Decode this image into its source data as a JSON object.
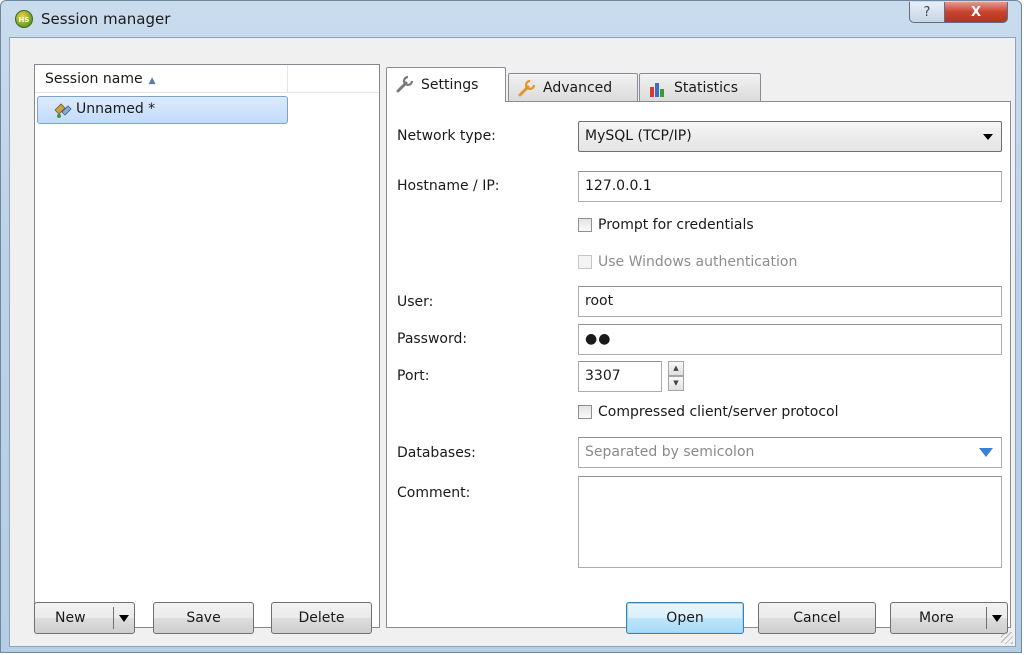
{
  "window": {
    "title": "Session manager",
    "icon": "heidisql-icon",
    "icon_text": "HS",
    "help_glyph": "?",
    "close_glyph": "X"
  },
  "session_list": {
    "column_header": "Session name",
    "sort_glyph": "▲",
    "items": [
      {
        "label": "Unnamed *",
        "icon": "connection-icon",
        "selected": true
      }
    ]
  },
  "tabs": [
    {
      "label": "Settings",
      "icon": "wrench-icon",
      "active": true
    },
    {
      "label": "Advanced",
      "icon": "wrench-icon",
      "active": false
    },
    {
      "label": "Statistics",
      "icon": "bar-chart-icon",
      "active": false
    }
  ],
  "settings": {
    "network_type": {
      "label": "Network type:",
      "value": "MySQL (TCP/IP)"
    },
    "hostname": {
      "label": "Hostname / IP:",
      "value": "127.0.0.1"
    },
    "prompt_credentials": {
      "label": "Prompt for credentials",
      "checked": false
    },
    "windows_auth": {
      "label": "Use Windows authentication",
      "checked": false,
      "disabled": true
    },
    "user": {
      "label": "User:",
      "value": "root"
    },
    "password": {
      "label": "Password:",
      "value": "●●"
    },
    "port": {
      "label": "Port:",
      "value": "3307",
      "up_glyph": "▲",
      "down_glyph": "▼"
    },
    "compressed": {
      "label": "Compressed client/server protocol",
      "checked": false
    },
    "databases": {
      "label": "Databases:",
      "value": "",
      "placeholder": "Separated by semicolon"
    },
    "comment": {
      "label": "Comment:",
      "value": ""
    }
  },
  "buttons": {
    "new": "New",
    "save": "Save",
    "delete": "Delete",
    "open": "Open",
    "cancel": "Cancel",
    "more": "More"
  }
}
